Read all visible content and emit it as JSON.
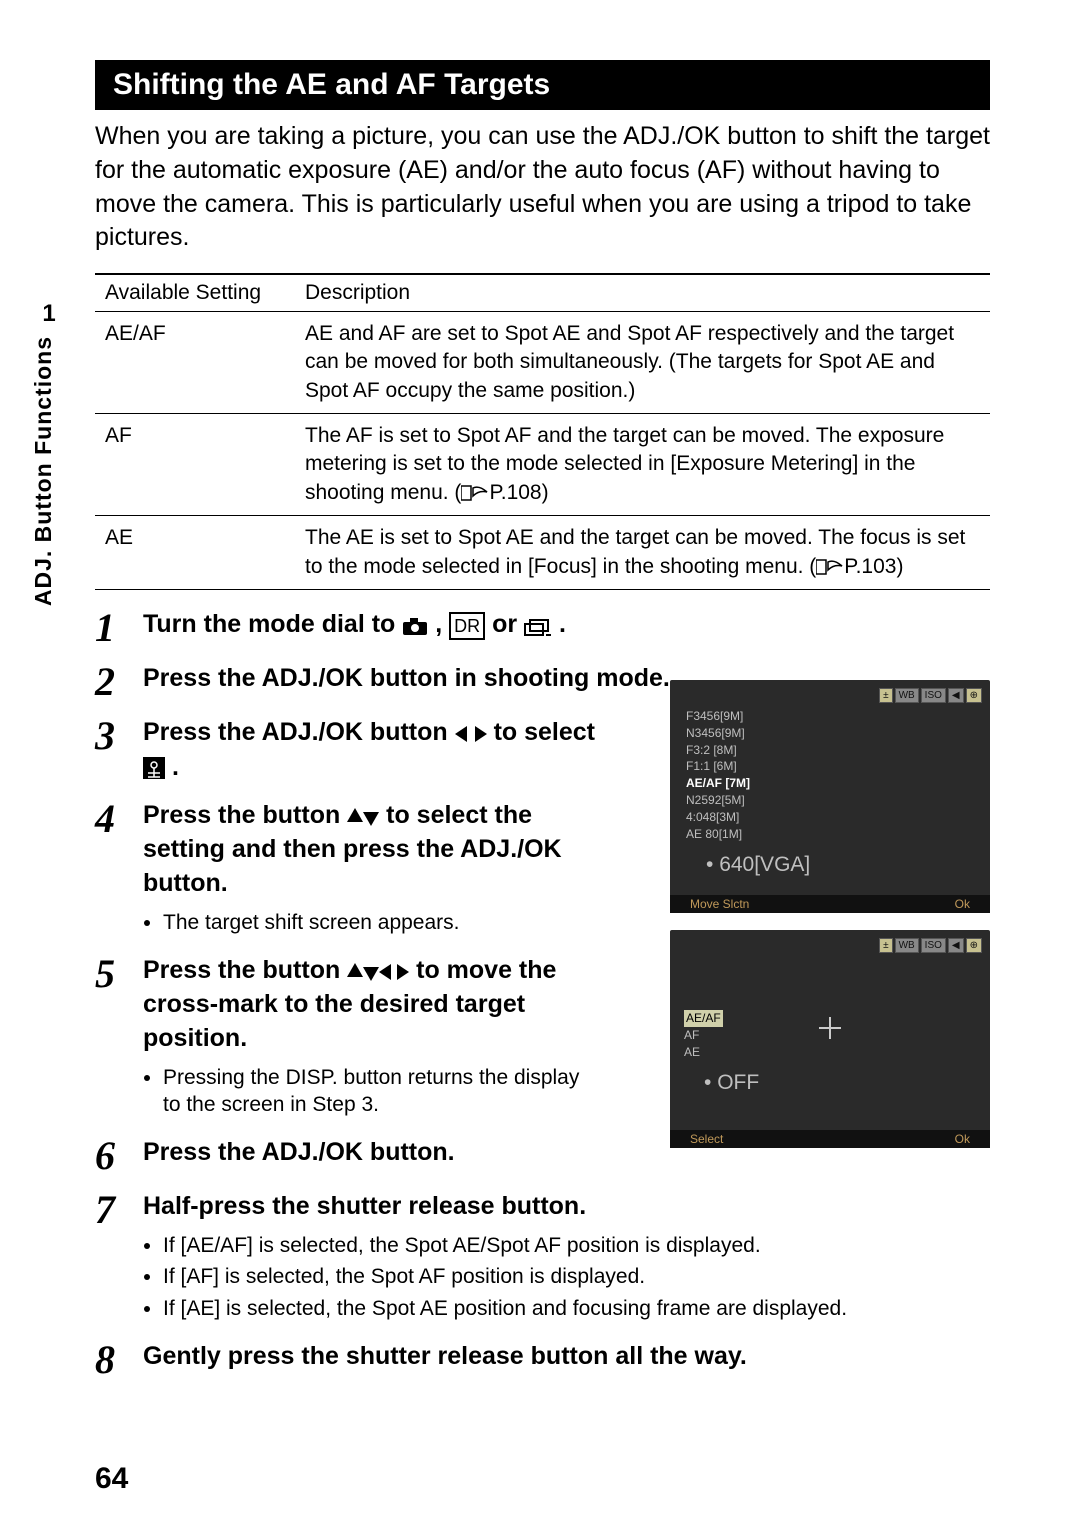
{
  "sidebar": {
    "chapter_num": "1",
    "chapter_title": "ADJ. Button Functions"
  },
  "title": "Shifting the AE and AF Targets",
  "intro": "When you are taking a picture, you can use the ADJ./OK button to shift the target for the automatic exposure (AE) and/or the auto focus (AF) without having to move the camera. This is particularly useful when you are using a tripod to take pictures.",
  "table": {
    "head": {
      "col1": "Available Setting",
      "col2": "Description"
    },
    "rows": [
      {
        "setting": "AE/AF",
        "desc": "AE and AF are set to Spot AE and Spot AF respectively and the target can be moved for both simultaneously. (The targets for Spot AE and Spot AF occupy the same position.)"
      },
      {
        "setting": "AF",
        "desc_a": "The AF is set to Spot AF and the target can be moved. The exposure metering is set to the mode selected in [Exposure Metering] in the shooting menu. (",
        "desc_ref": "P.108",
        "desc_b": ")"
      },
      {
        "setting": "AE",
        "desc_a": "The AE is set to Spot AE and the target can be moved. The focus is set to the mode selected in [Focus] in the shooting menu. (",
        "desc_ref": "P.103",
        "desc_b": ")"
      }
    ]
  },
  "steps": [
    {
      "n": "1",
      "head_a": "Turn the mode dial to ",
      "head_b": ", ",
      "head_c": " or ",
      "head_d": "."
    },
    {
      "n": "2",
      "head": "Press the ADJ./OK button in shooting mode."
    },
    {
      "n": "3",
      "head_a": "Press the ADJ./OK button ",
      "head_b": " to select ",
      "head_c": "."
    },
    {
      "n": "4",
      "head_a": "Press the button ",
      "head_b": " to select the setting and then press the ADJ./OK button.",
      "bullet": "The target shift screen appears."
    },
    {
      "n": "5",
      "head_a": "Press the button ",
      "head_b": " to move the cross-mark to the desired target position.",
      "bullet": "Pressing the DISP. button returns the display to the screen in Step 3."
    },
    {
      "n": "6",
      "head": "Press the ADJ./OK button."
    },
    {
      "n": "7",
      "head": "Half-press the shutter release button.",
      "bullets": [
        "If [AE/AF] is selected, the Spot AE/Spot AF position is displayed.",
        "If [AF] is selected, the Spot AF position is displayed.",
        "If [AE] is selected, the Spot AE position and focusing frame are displayed."
      ]
    },
    {
      "n": "8",
      "head": "Gently press the shutter release button all the way."
    }
  ],
  "lcd1": {
    "lines": [
      "F3456[9M]",
      "N3456[9M]",
      "F3:2 [8M]",
      "F1:1 [6M]",
      "AE/AF [7M]",
      "N2592[5M]",
      "4:048[3M]",
      "AE 80[1M]",
      "640[VGA]"
    ],
    "hl_index": 4,
    "bullet_index": 8,
    "foot_left": "Move Slctn",
    "foot_right": "Ok",
    "icons": [
      "±",
      "WB",
      "ISO",
      "◀",
      "⊕"
    ]
  },
  "lcd2": {
    "lines": [
      "AE/AF",
      "AF",
      "AE",
      "OFF"
    ],
    "hl_index": 0,
    "bullet_index": 3,
    "foot_left": "Select",
    "foot_right": "Ok",
    "icons": [
      "±",
      "WB",
      "ISO",
      "◀",
      "⊕"
    ]
  },
  "page_number": "64",
  "icons": {
    "camera": "camera-icon",
    "dr": "DR",
    "burst": "burst-icon",
    "lr": "left-right-arrows",
    "target": "target-icon",
    "ud": "up-down-arrows",
    "udlr": "four-way-arrows",
    "book": "reference-icon"
  }
}
